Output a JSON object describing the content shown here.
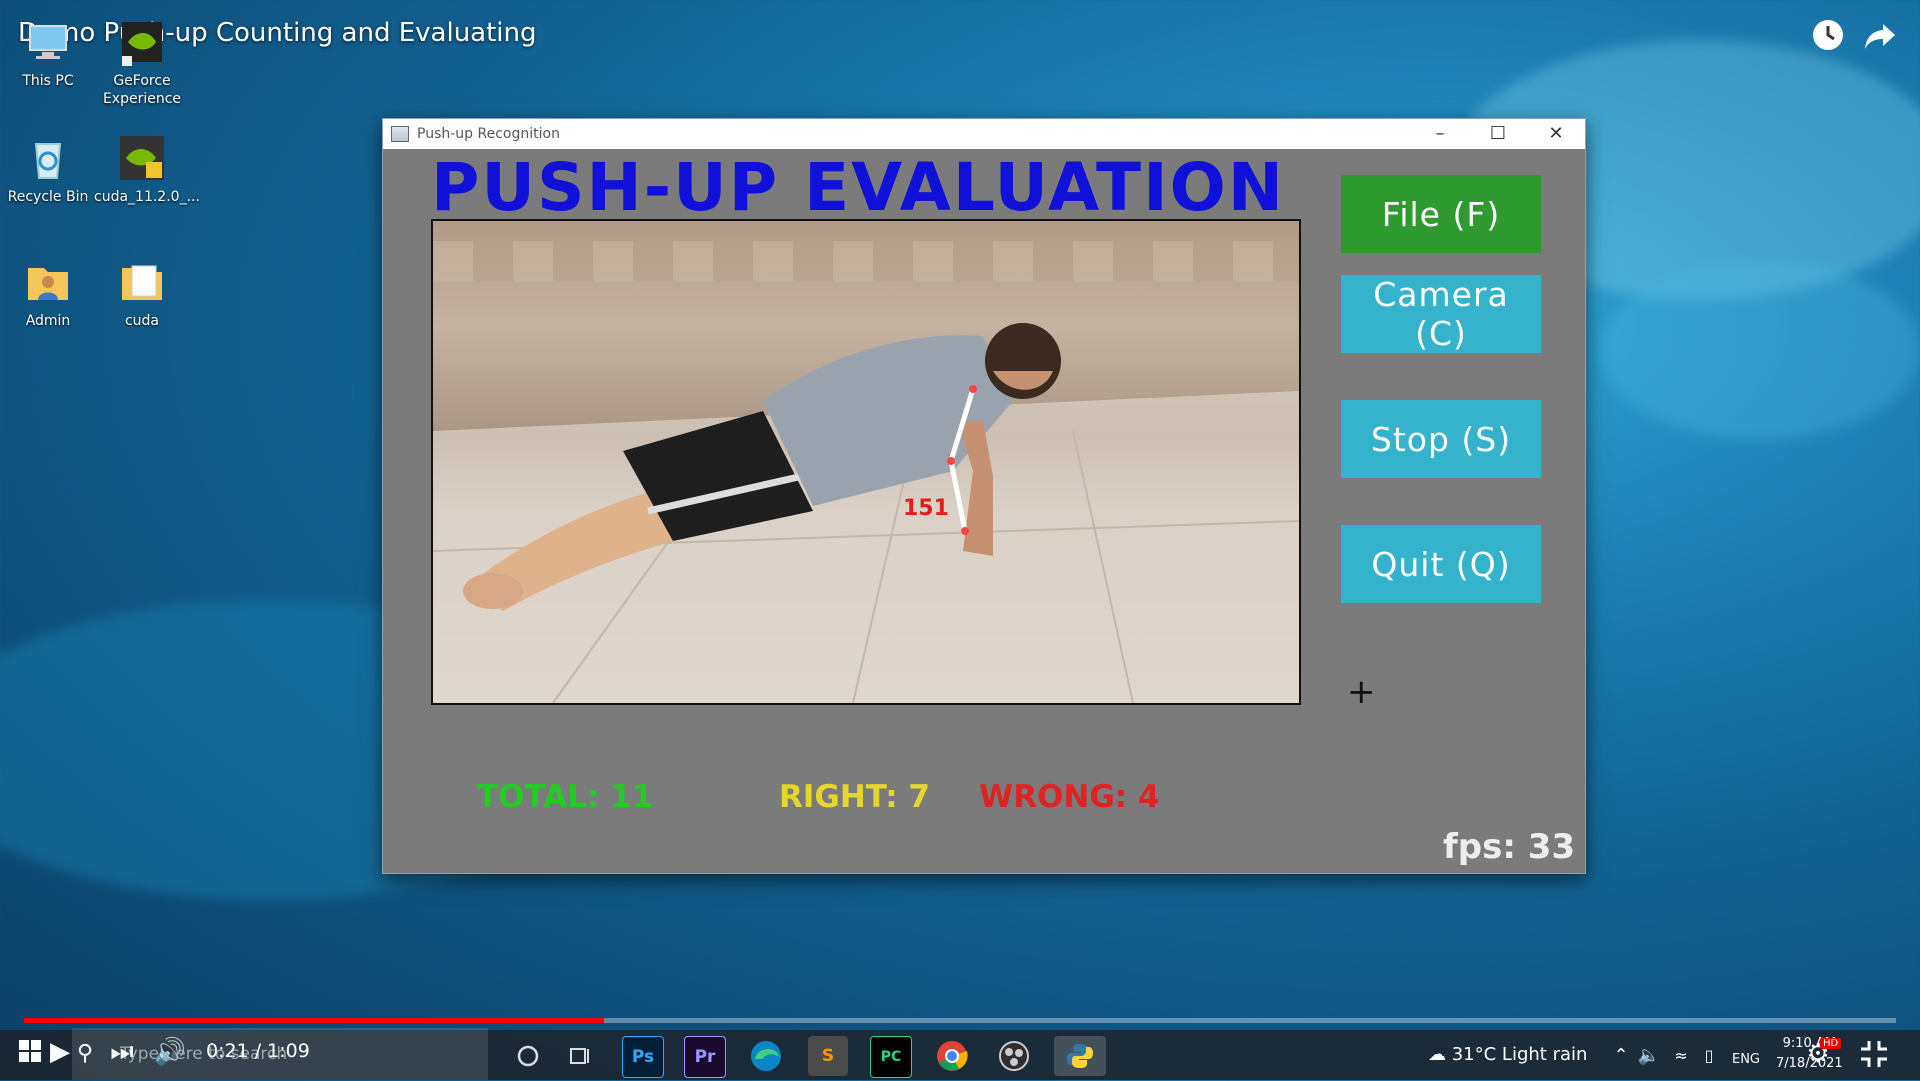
{
  "youtube": {
    "video_title": "Demo Push-up Counting and Evaluating",
    "time_current": "0:21",
    "time_total": "1:09",
    "timecode": "0:21 / 1:09",
    "progress": 0.31,
    "icons": [
      "watch-later-icon",
      "share-icon",
      "play-icon",
      "next-icon",
      "volume-icon",
      "settings-icon",
      "exit-fullscreen-icon"
    ],
    "hd_badge": "HD"
  },
  "desktop": {
    "icons": [
      {
        "label": "This PC",
        "icon": "computer-icon"
      },
      {
        "label": "GeForce Experience",
        "icon": "geforce-icon"
      },
      {
        "label": "Recycle Bin",
        "icon": "recycle-bin-icon"
      },
      {
        "label": "cuda_11.2.0_...",
        "icon": "nvidia-installer-icon"
      },
      {
        "label": "Admin",
        "icon": "user-folder-icon"
      },
      {
        "label": "cuda",
        "icon": "folder-icon"
      }
    ]
  },
  "window": {
    "title": "Push-up Recognition",
    "heading": "PUSH-UP EVALUATION",
    "pose_angle": "151",
    "buttons": {
      "file": "File (F)",
      "camera": "Camera (C)",
      "stop": "Stop (S)",
      "quit": "Quit (Q)"
    },
    "stats": {
      "total": "TOTAL: 11",
      "right": "RIGHT: 7",
      "wrong": "WRONG: 4"
    },
    "fps": "fps: 33",
    "colors": {
      "heading": "#1010d8",
      "file_button": "#2f9a2f",
      "other_buttons": "#35b3cc",
      "total": "#22cc22",
      "right": "#e6d62a",
      "wrong": "#e02222"
    }
  },
  "taskbar": {
    "search_placeholder": "Type here to search",
    "apps": [
      "Ps",
      "Pr",
      "Edge",
      "Sublime",
      "PC",
      "Chrome",
      "OBS",
      "Python"
    ],
    "weather": "31°C  Light rain",
    "time": "9:10 AM",
    "date": "7/18/2021",
    "lang": "ENG"
  }
}
